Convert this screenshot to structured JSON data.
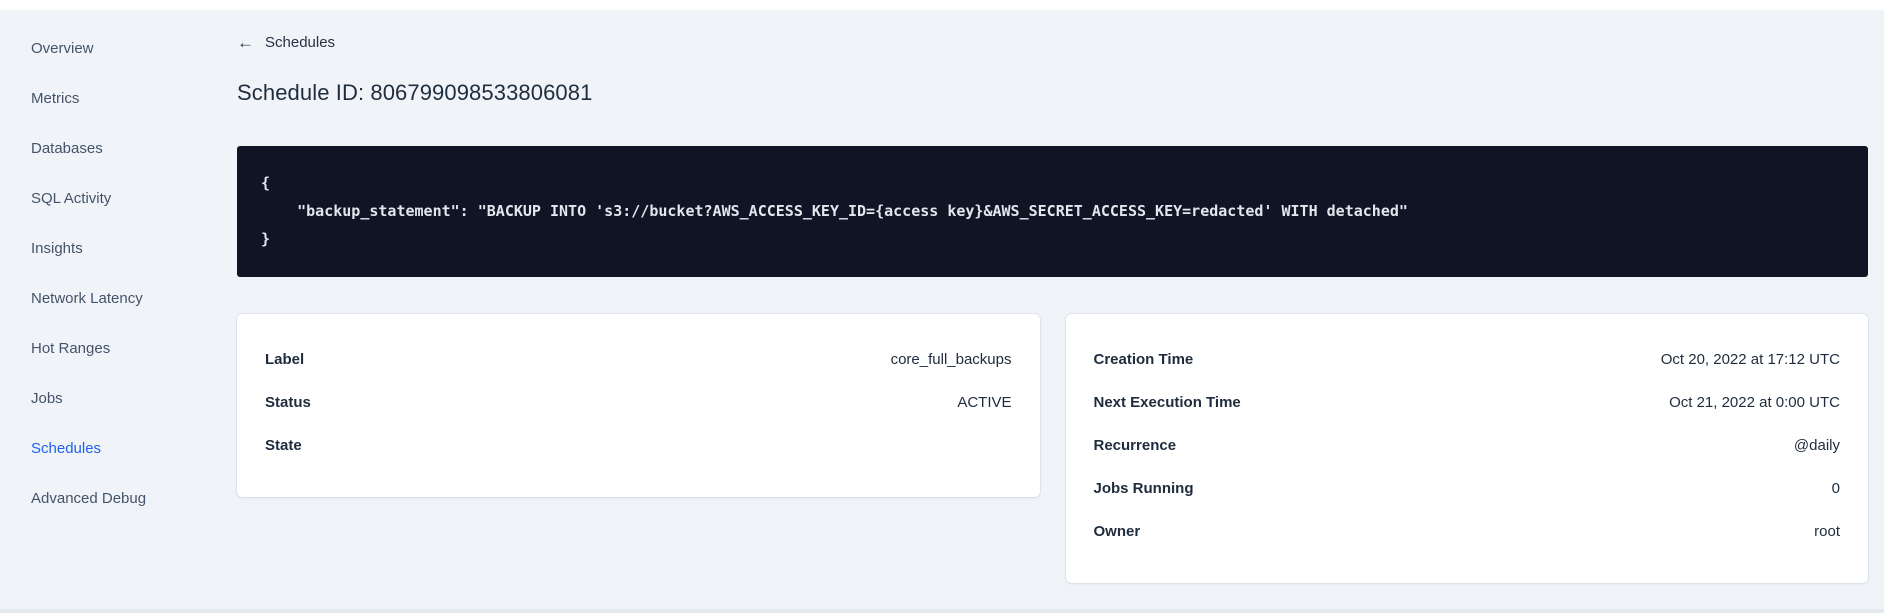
{
  "sidebar": {
    "items": [
      {
        "label": "Overview",
        "active": false
      },
      {
        "label": "Metrics",
        "active": false
      },
      {
        "label": "Databases",
        "active": false
      },
      {
        "label": "SQL Activity",
        "active": false
      },
      {
        "label": "Insights",
        "active": false
      },
      {
        "label": "Network Latency",
        "active": false
      },
      {
        "label": "Hot Ranges",
        "active": false
      },
      {
        "label": "Jobs",
        "active": false
      },
      {
        "label": "Schedules",
        "active": true
      },
      {
        "label": "Advanced Debug",
        "active": false
      }
    ]
  },
  "header": {
    "back_icon": "←",
    "back_label": "Schedules",
    "title": "Schedule ID: 806799098533806081"
  },
  "code_block": {
    "text": "{\n    \"backup_statement\": \"BACKUP INTO 's3://bucket?AWS_ACCESS_KEY_ID={access key}&AWS_SECRET_ACCESS_KEY=redacted' WITH detached\"\n}"
  },
  "details_card": {
    "rows": [
      {
        "label": "Label",
        "value": "core_full_backups"
      },
      {
        "label": "Status",
        "value": "ACTIVE"
      },
      {
        "label": "State",
        "value": ""
      }
    ]
  },
  "schedule_card": {
    "rows": [
      {
        "label": "Creation Time",
        "value": "Oct 20, 2022 at 17:12 UTC"
      },
      {
        "label": "Next Execution Time",
        "value": "Oct 21, 2022 at 0:00 UTC"
      },
      {
        "label": "Recurrence",
        "value": "@daily"
      },
      {
        "label": "Jobs Running",
        "value": "0"
      },
      {
        "label": "Owner",
        "value": "root"
      }
    ]
  },
  "colors": {
    "accent_blue": "#2161f0",
    "page_bg": "#f0f4f8",
    "code_bg": "#0f1524",
    "text_dark": "#1f2c3d"
  }
}
